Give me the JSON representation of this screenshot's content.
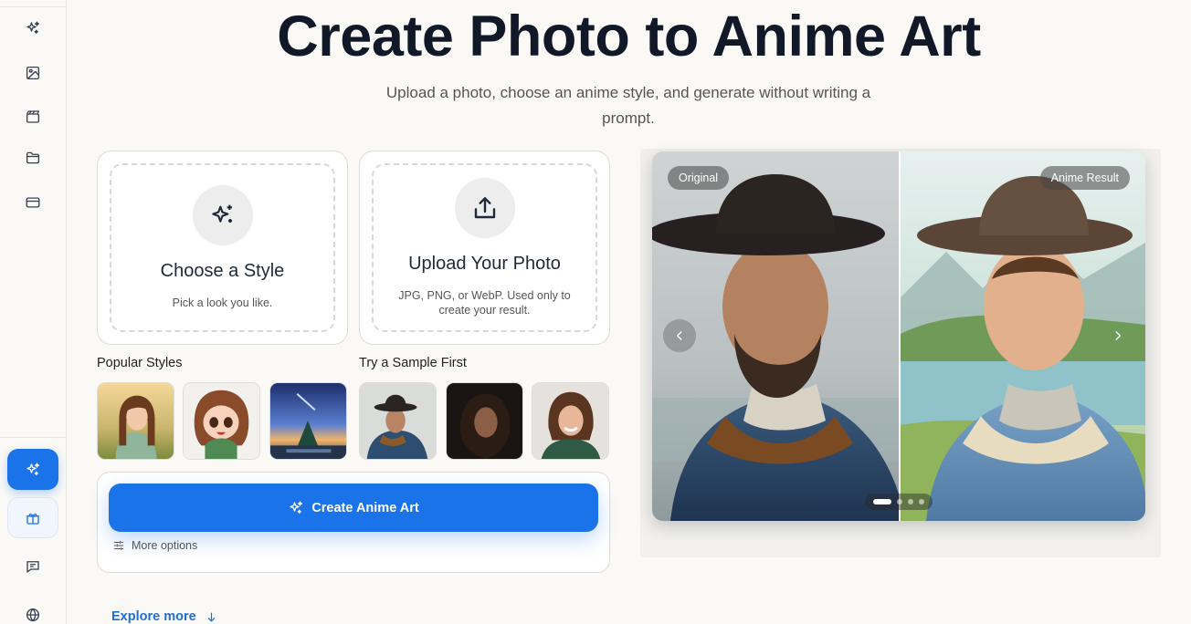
{
  "sidebar": {
    "items": [
      {
        "icon": "sparkles-icon"
      },
      {
        "icon": "image-icon"
      },
      {
        "icon": "video-icon"
      },
      {
        "icon": "folder-icon"
      },
      {
        "icon": "credit-card-icon"
      }
    ],
    "active_item": {
      "icon": "sparkles-icon"
    },
    "promo_item": {
      "icon": "gift-icon"
    },
    "bottom_items": [
      {
        "icon": "chat-icon"
      },
      {
        "icon": "globe-icon"
      }
    ]
  },
  "header": {
    "title": "Create Photo to Anime Art",
    "subtitle": "Upload a photo, choose an anime style, and generate without writing a prompt."
  },
  "style_card": {
    "title": "Choose a Style",
    "description": "Pick a look you like."
  },
  "upload_card": {
    "title": "Upload Your Photo",
    "description": "JPG, PNG, or WebP. Used only to create your result."
  },
  "popular_styles": {
    "label": "Popular Styles"
  },
  "samples": {
    "label": "Try a Sample First"
  },
  "action": {
    "create_label": "Create Anime Art",
    "more_options_label": "More options"
  },
  "explore_label": "Explore more",
  "preview": {
    "left_label": "Original",
    "right_label": "Anime Result",
    "slide_count": 4,
    "active_slide": 1
  },
  "colors": {
    "accent": "#1a73e8",
    "background": "#faf9f6"
  }
}
